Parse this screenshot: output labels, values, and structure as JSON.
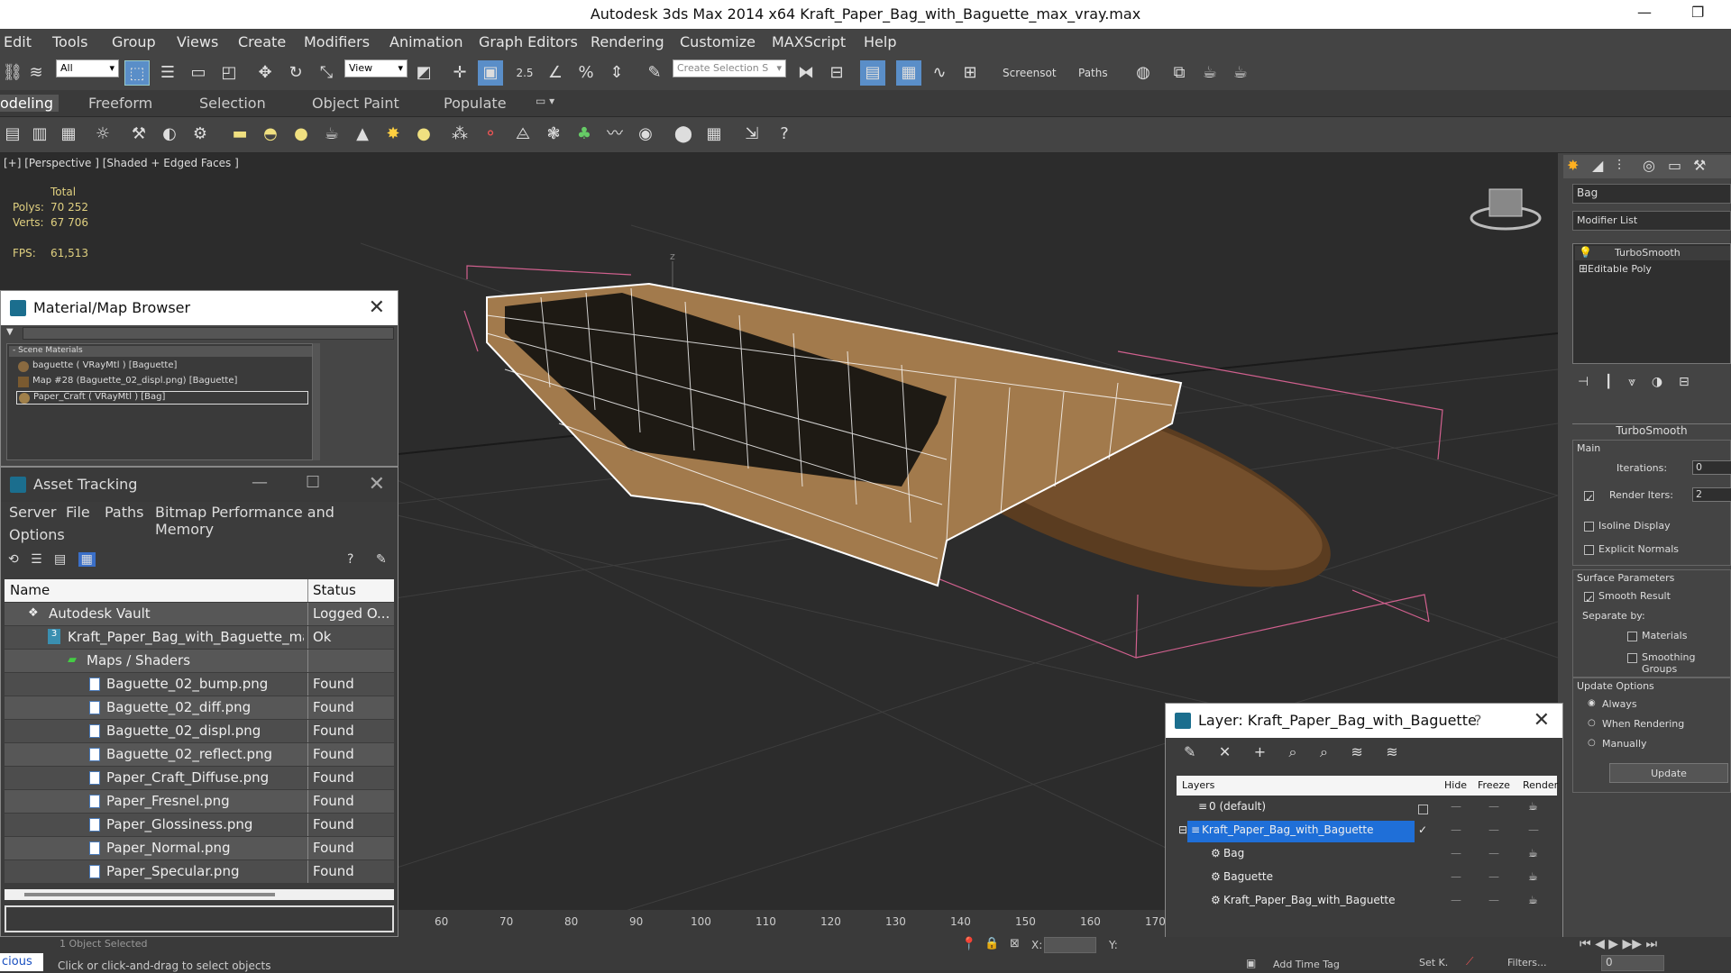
{
  "window": {
    "title": "Autodesk 3ds Max  2014 x64      Kraft_Paper_Bag_with_Baguette_max_vray.max",
    "minimize": "—",
    "restore": "❐"
  },
  "menu": [
    "Edit",
    "Tools",
    "Group",
    "Views",
    "Create",
    "Modifiers",
    "Animation",
    "Graph Editors",
    "Rendering",
    "Customize",
    "MAXScript",
    "Help"
  ],
  "toolbar": {
    "selection_filter": "All",
    "ref_coord": "View",
    "named_selection": "Create Selection S",
    "screenshot_label": "Screensot",
    "paths_label": "Paths",
    "snap_value": "2.5"
  },
  "ribbon_tabs": [
    "odeling",
    "Freeform",
    "Selection",
    "Object Paint",
    "Populate"
  ],
  "viewport": {
    "label": "[+] [Perspective ] [Shaded + Edged Faces ]",
    "stats": {
      "total_label": "Total",
      "polys_label": "Polys:",
      "polys": "70 252",
      "verts_label": "Verts:",
      "verts": "67 706",
      "fps_label": "FPS:",
      "fps": "61,513"
    },
    "axis_label": "z"
  },
  "material_browser": {
    "title": "Material/Map Browser",
    "group": "- Scene Materials",
    "items": [
      "baguette  ( VRayMtl ) [Baguette]",
      "Map #28 (Baguette_02_displ.png) [Baguette]",
      "Paper_Craft  ( VRayMtl ) [Bag]"
    ]
  },
  "asset_tracking": {
    "title": "Asset Tracking",
    "menu": [
      "Server",
      "File",
      "Paths",
      "Bitmap Performance and Memory",
      "Options"
    ],
    "col_name": "Name",
    "col_status": "Status",
    "rows": [
      {
        "name": "Autodesk Vault",
        "status": "Logged O...",
        "indent": 0
      },
      {
        "name": "Kraft_Paper_Bag_with_Baguette_ma...",
        "status": "Ok",
        "indent": 1
      },
      {
        "name": "Maps / Shaders",
        "status": "",
        "indent": 2
      },
      {
        "name": "Baguette_02_bump.png",
        "status": "Found",
        "indent": 3
      },
      {
        "name": "Baguette_02_diff.png",
        "status": "Found",
        "indent": 3
      },
      {
        "name": "Baguette_02_displ.png",
        "status": "Found",
        "indent": 3
      },
      {
        "name": "Baguette_02_reflect.png",
        "status": "Found",
        "indent": 3
      },
      {
        "name": "Paper_Craft_Diffuse.png",
        "status": "Found",
        "indent": 3
      },
      {
        "name": "Paper_Fresnel.png",
        "status": "Found",
        "indent": 3
      },
      {
        "name": "Paper_Glossiness.png",
        "status": "Found",
        "indent": 3
      },
      {
        "name": "Paper_Normal.png",
        "status": "Found",
        "indent": 3
      },
      {
        "name": "Paper_Specular.png",
        "status": "Found",
        "indent": 3
      }
    ]
  },
  "layer_window": {
    "title": "Layer: Kraft_Paper_Bag_with_Baguette",
    "help": "?",
    "col_layers": "Layers",
    "col_hide": "Hide",
    "col_freeze": "Freeze",
    "col_render": "Render",
    "rows": [
      {
        "name": "0 (default)",
        "indent": 0,
        "selected": false
      },
      {
        "name": "Kraft_Paper_Bag_with_Baguette",
        "indent": 0,
        "selected": true
      },
      {
        "name": "Bag",
        "indent": 1,
        "selected": false
      },
      {
        "name": "Baguette",
        "indent": 1,
        "selected": false
      },
      {
        "name": "Kraft_Paper_Bag_with_Baguette",
        "indent": 1,
        "selected": false
      }
    ]
  },
  "command_panel": {
    "object_name": "Bag",
    "modifier_list": "Modifier List",
    "stack": [
      "TurboSmooth",
      "Editable Poly"
    ],
    "rollout_title": "TurboSmooth",
    "main_label": "Main",
    "iterations_label": "Iterations:",
    "iterations": "0",
    "render_iters_label": "Render Iters:",
    "render_iters": "2",
    "isoline": "Isoline Display",
    "explicit_normals": "Explicit Normals",
    "surface_params": "Surface Parameters",
    "smooth_result": "Smooth Result",
    "separate_by": "Separate by:",
    "materials": "Materials",
    "smoothing_groups": "Smoothing Groups",
    "update_options": "Update Options",
    "always": "Always",
    "when_rendering": "When Rendering",
    "manually": "Manually",
    "update_btn": "Update"
  },
  "timeline": {
    "ticks": [
      "60",
      "70",
      "80",
      "90",
      "100",
      "110",
      "120",
      "130",
      "140",
      "150",
      "160",
      "170"
    ]
  },
  "status": {
    "selected": "1 Object Selected",
    "prompt": "Click or click-and-drag to select objects",
    "maxscript": "cious",
    "x_label": "X:",
    "y_label": "Y:",
    "add_time_tag": "Add Time Tag",
    "set_k": "Set K.",
    "filters": "Filters...",
    "frame": "0"
  }
}
